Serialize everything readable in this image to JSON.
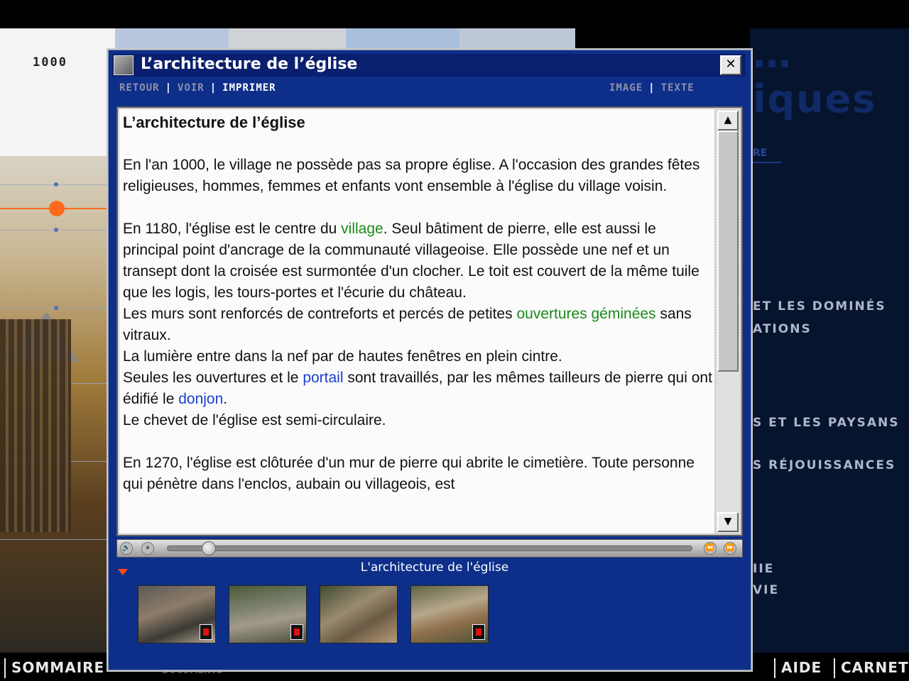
{
  "background": {
    "year_label": "1000",
    "right_title": "…iques",
    "right_link_text": "RE",
    "right_menu": [
      "ET LES DOMINÉS",
      "ATIONS",
      "S ET LES PAYSANS",
      "S RÉJOUISSANCES",
      "IIE",
      "VIE"
    ]
  },
  "bottom_nav": {
    "sommaire": "SOMMAIRE",
    "documents": "DOCUMENTS",
    "aide": "AIDE",
    "carnet": "CARNET"
  },
  "dialog": {
    "title": "L’architecture de l’église",
    "close_label": "✕",
    "toolbar": {
      "retour": "RETOUR",
      "voir": "VOIR",
      "imprimer": "IMPRIMER",
      "image": "IMAGE",
      "texte": "TEXTE",
      "separator": "|"
    },
    "content": {
      "heading": "L’architecture de l’église",
      "p1": "En l'an 1000, le village ne possède pas sa propre église. A l'occasion des grandes fêtes religieuses, hommes, femmes et enfants vont ensemble à l'église du village voisin.",
      "p2_a": "En 1180, l'église est le centre du ",
      "p2_link_village": "village",
      "p2_b": ". Seul bâtiment de pierre, elle est aussi le principal point d'ancrage de la communauté villageoise. Elle possède une nef et un transept dont la croisée est surmontée d'un clocher. Le toit est couvert de la même tuile que les logis, les tours-portes et l'écurie du château.",
      "p2_c": "Les murs sont renforcés de contreforts et percés de petites ",
      "p2_link_ouvertures": "ouvertures géminées",
      "p2_d": " sans vitraux.",
      "p2_e": "La lumière entre dans la nef par de hautes fenêtres en plein cintre.",
      "p2_f": "Seules les ouvertures et le ",
      "p2_link_portail": "portail",
      "p2_g": " sont travaillés, par les mêmes tailleurs de pierre qui ont édifié le ",
      "p2_link_donjon": "donjon",
      "p2_h": ".",
      "p2_i": "Le chevet de l'église est semi-circulaire.",
      "p3": "En 1270, l'église est clôturée d'un mur de pierre qui abrite le cimetière. Toute personne qui pénètre dans l'enclos, aubain ou villageois, est"
    },
    "scrollbar": {
      "up": "▲",
      "down": "▼"
    },
    "media_bar": {
      "sound": "🔊",
      "pause": "⏸",
      "rewind": "⏪",
      "forward": "⏩",
      "progress": 0.08
    },
    "caption": "L'architecture de l'église",
    "thumbnails": [
      {
        "name": "thumbnail-1",
        "has_video": true
      },
      {
        "name": "thumbnail-2",
        "has_video": true
      },
      {
        "name": "thumbnail-3",
        "has_video": false
      },
      {
        "name": "thumbnail-4",
        "has_video": true
      }
    ]
  },
  "colors": {
    "dialog_blue": "#0d2f8a",
    "titlebar_blue": "#0a1f6e",
    "link_green": "#1a8a1a",
    "link_blue": "#1b3fd0",
    "accent_orange": "#ff6a1a"
  }
}
